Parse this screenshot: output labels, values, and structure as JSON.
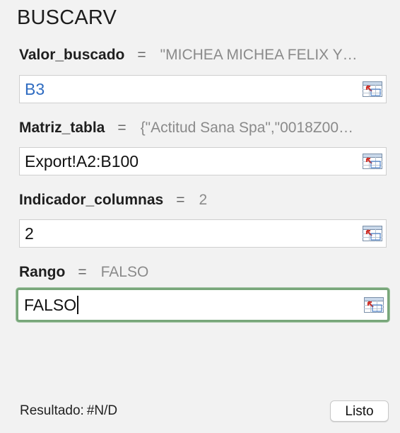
{
  "function_name": "BUSCARV",
  "arguments": [
    {
      "name": "Valor_buscado",
      "equals": "=",
      "preview": "\"MICHEA MICHEA FELIX Y…",
      "value": "B3"
    },
    {
      "name": "Matriz_tabla",
      "equals": "=",
      "preview": "{\"Actitud Sana Spa\",\"0018Z00…",
      "value": "Export!A2:B100"
    },
    {
      "name": "Indicador_columnas",
      "equals": "=",
      "preview": "2",
      "value": "2"
    },
    {
      "name": "Rango",
      "equals": "=",
      "preview": "FALSO",
      "value": "FALSO"
    }
  ],
  "result": {
    "label": "Resultado:",
    "value": "#N/D"
  },
  "done_label": "Listo",
  "colors": {
    "reference_text": "#2f6cc1",
    "active_border": "#78a67a"
  },
  "icons": {
    "collapse": "collapse-dialog-icon"
  }
}
